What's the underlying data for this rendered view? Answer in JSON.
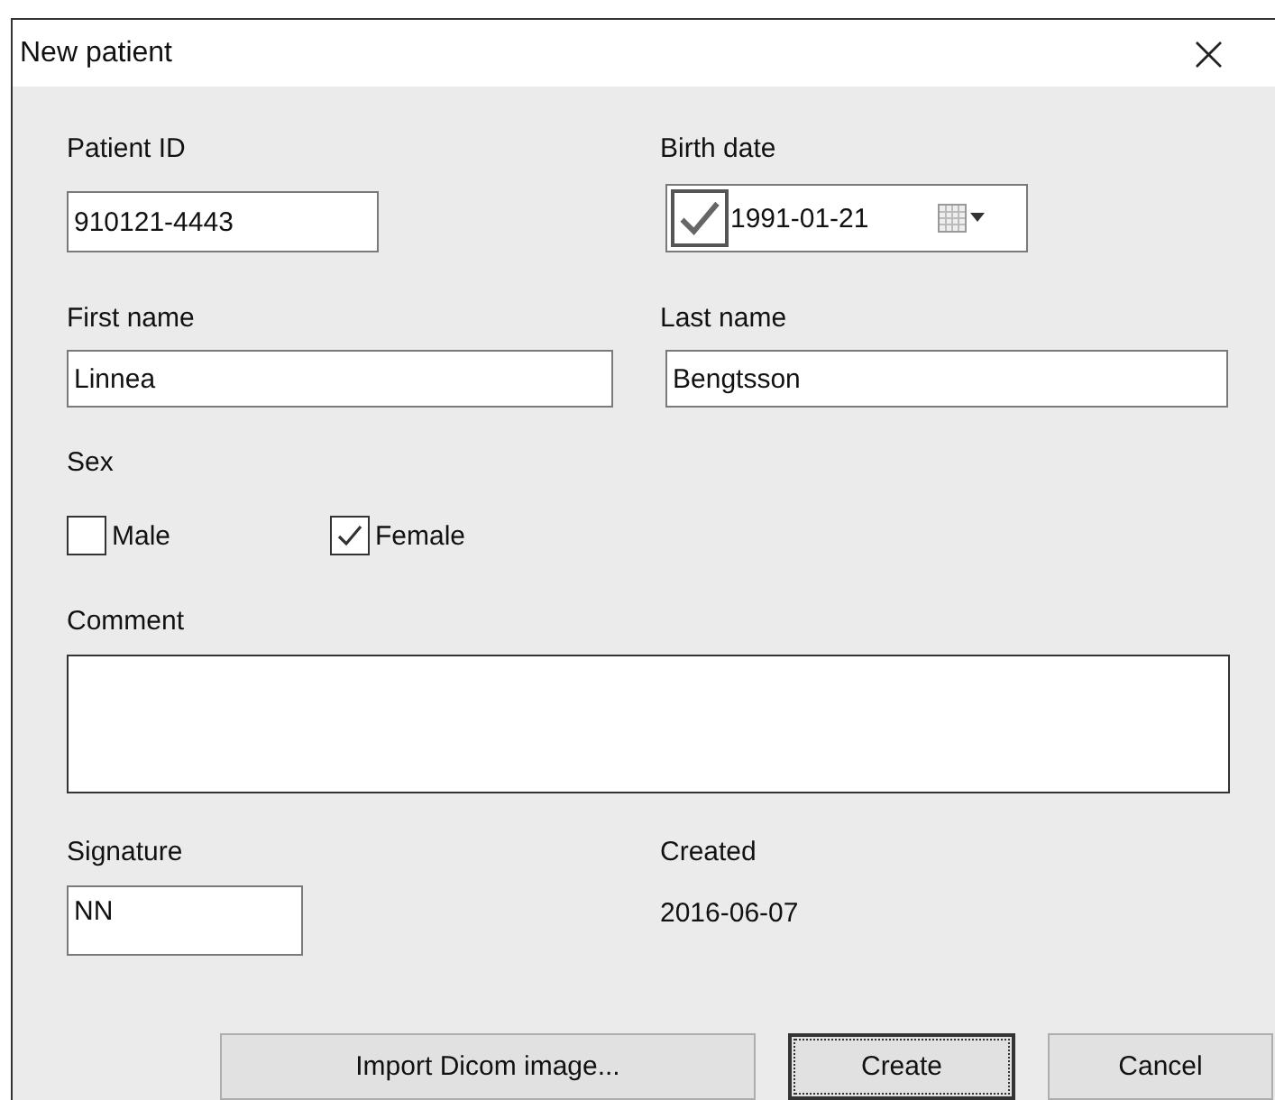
{
  "window": {
    "title": "New patient",
    "close": "×"
  },
  "patient_id": {
    "label": "Patient ID",
    "value": "910121-4443"
  },
  "birth_date": {
    "label": "Birth date",
    "checked": true,
    "value": "1991-01-21"
  },
  "first_name": {
    "label": "First name",
    "value": "Linnea"
  },
  "last_name": {
    "label": "Last name",
    "value": "Bengtsson"
  },
  "sex": {
    "label": "Sex",
    "options": [
      {
        "label": "Male",
        "checked": false
      },
      {
        "label": "Female",
        "checked": true
      }
    ]
  },
  "comment": {
    "label": "Comment"
  },
  "signature": {
    "label": "Signature",
    "value": "NN"
  },
  "created": {
    "label": "Created",
    "value": "2016-06-07"
  },
  "buttons": [
    {
      "label": "Import Dicom image...",
      "default": false
    },
    {
      "label": "Create",
      "default": true
    },
    {
      "label": "Cancel",
      "default": false
    }
  ]
}
